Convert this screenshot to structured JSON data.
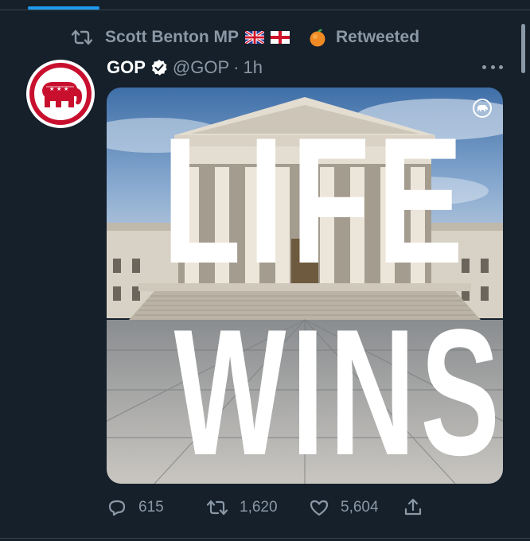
{
  "retweet_context": {
    "icon": "retweet-icon",
    "name": "Scott Benton MP",
    "emojis": [
      "uk-flag",
      "england-flag",
      "peach"
    ],
    "label": "Retweeted"
  },
  "tweet": {
    "author": {
      "display_name": "GOP",
      "verified": true,
      "handle": "@GOP",
      "separator": "·",
      "timestamp": "1h",
      "avatar_icon": "republican-elephant-logo"
    },
    "media": {
      "overlay_line_1": "LIFE",
      "overlay_line_2": "WINS",
      "scene": "supreme-court-building",
      "badge_icon": "gop-elephant-badge"
    },
    "actions": {
      "reply_count": "615",
      "retweet_count": "1,620",
      "like_count": "5,604",
      "share_icon": "share-icon"
    }
  },
  "colors": {
    "background": "#15202b",
    "secondary_text": "#8b98a5",
    "primary_text": "#ffffff",
    "accent": "#1d9bf0",
    "gop_red": "#c8102e"
  }
}
